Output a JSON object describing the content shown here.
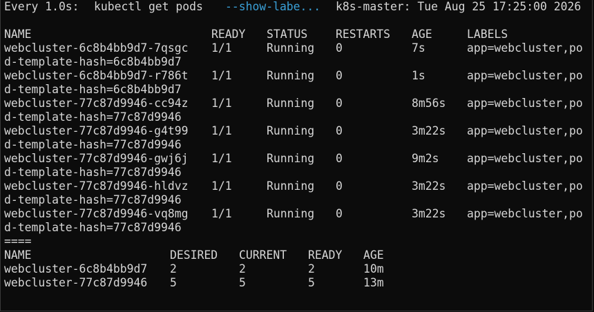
{
  "watch_header": {
    "interval": "Every 1.0s:",
    "command": "kubectl get pods",
    "flag": "--show-labe...",
    "host_time": "k8s-master: Tue Aug 25 17:25:00 2026"
  },
  "pods": {
    "headers": [
      "NAME",
      "READY",
      "STATUS",
      "RESTARTS",
      "AGE",
      "LABELS"
    ],
    "rows": [
      {
        "name": "webcluster-6c8b4bb9d7-7qsgc",
        "ready": "1/1",
        "status": "Running",
        "restarts": "0",
        "age": "7s",
        "labels": "app=webcluster,po",
        "labels_wrap": "d-template-hash=6c8b4bb9d7"
      },
      {
        "name": "webcluster-6c8b4bb9d7-r786t",
        "ready": "1/1",
        "status": "Running",
        "restarts": "0",
        "age": "1s",
        "labels": "app=webcluster,po",
        "labels_wrap": "d-template-hash=6c8b4bb9d7"
      },
      {
        "name": "webcluster-77c87d9946-cc94z",
        "ready": "1/1",
        "status": "Running",
        "restarts": "0",
        "age": "8m56s",
        "labels": "app=webcluster,po",
        "labels_wrap": "d-template-hash=77c87d9946"
      },
      {
        "name": "webcluster-77c87d9946-g4t99",
        "ready": "1/1",
        "status": "Running",
        "restarts": "0",
        "age": "3m22s",
        "labels": "app=webcluster,po",
        "labels_wrap": "d-template-hash=77c87d9946"
      },
      {
        "name": "webcluster-77c87d9946-gwj6j",
        "ready": "1/1",
        "status": "Running",
        "restarts": "0",
        "age": "9m2s",
        "labels": "app=webcluster,po",
        "labels_wrap": "d-template-hash=77c87d9946"
      },
      {
        "name": "webcluster-77c87d9946-hldvz",
        "ready": "1/1",
        "status": "Running",
        "restarts": "0",
        "age": "3m22s",
        "labels": "app=webcluster,po",
        "labels_wrap": "d-template-hash=77c87d9946"
      },
      {
        "name": "webcluster-77c87d9946-vq8mg",
        "ready": "1/1",
        "status": "Running",
        "restarts": "0",
        "age": "3m22s",
        "labels": "app=webcluster,po",
        "labels_wrap": "d-template-hash=77c87d9946"
      }
    ]
  },
  "separator": "====",
  "replicasets": {
    "headers": [
      "NAME",
      "DESIRED",
      "CURRENT",
      "READY",
      "AGE"
    ],
    "rows": [
      {
        "name": "webcluster-6c8b4bb9d7",
        "desired": "2",
        "current": "2",
        "ready": "2",
        "age": "10m"
      },
      {
        "name": "webcluster-77c87d9946",
        "desired": "5",
        "current": "5",
        "ready": "5",
        "age": "13m"
      }
    ]
  },
  "colors": {
    "background": "#0c0c0c",
    "foreground": "#d6d6d6",
    "flag": "#3aa0d8"
  }
}
